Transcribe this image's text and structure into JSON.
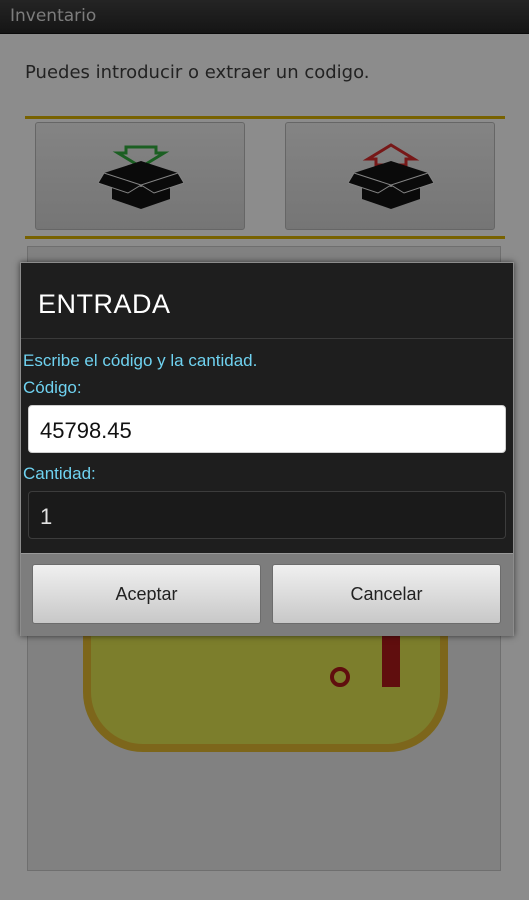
{
  "app": {
    "title": "Inventario",
    "intro": "Puedes introducir o extraer un codigo."
  },
  "actions": [
    {
      "name": "entrada",
      "icon": "box-in-icon",
      "accent": "#2e9e3a"
    },
    {
      "name": "salida",
      "icon": "box-out-icon",
      "accent": "#c62828"
    }
  ],
  "dialog": {
    "title": "ENTRADA",
    "message": "Escribe el código y la cantidad.",
    "code_label": "Código:",
    "code_value": "45798.45",
    "qty_label": "Cantidad:",
    "qty_value": "1",
    "accept_label": "Aceptar",
    "cancel_label": "Cancelar"
  },
  "colors": {
    "label": "#6fd2f0",
    "divider": "#c9a400",
    "dialog_bg": "#1e1e1e"
  }
}
